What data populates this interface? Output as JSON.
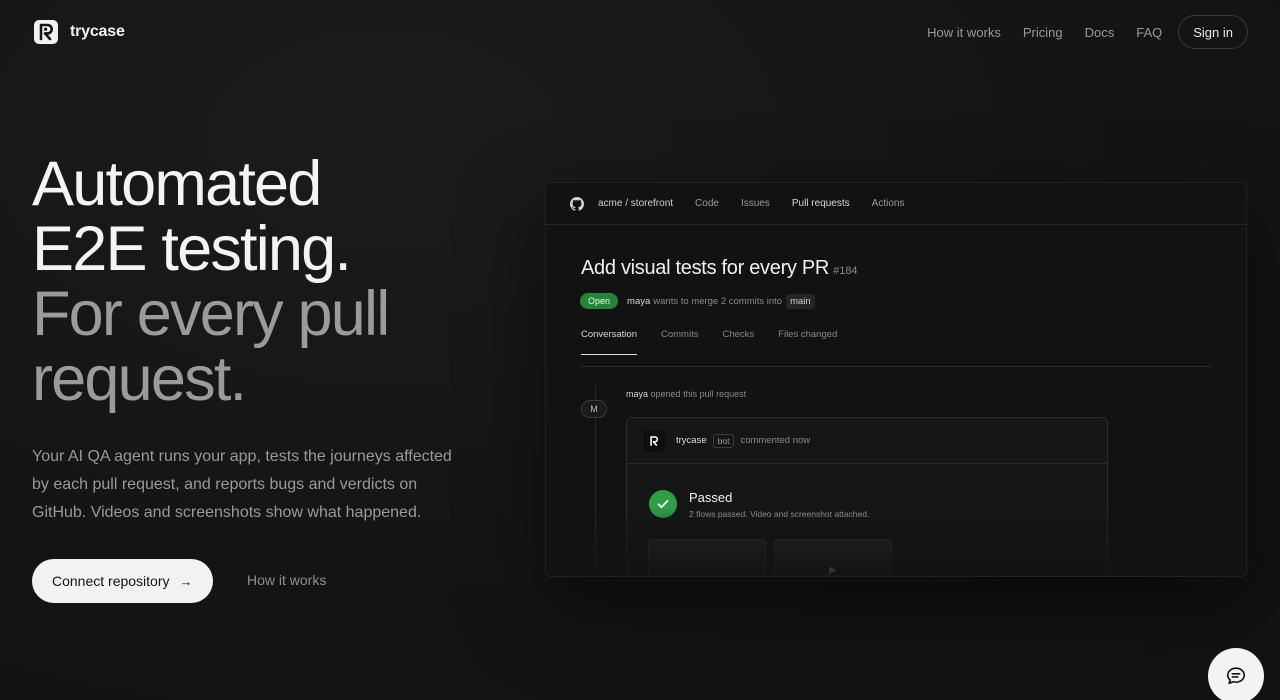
{
  "brand": {
    "name": "trycase"
  },
  "nav": {
    "items": [
      "How it works",
      "Pricing",
      "Docs",
      "FAQ"
    ],
    "signin": "Sign in"
  },
  "hero": {
    "line1": "Automated",
    "line2": "E2E testing.",
    "line3": "For every pull request.",
    "description": "Your AI QA agent runs your app, tests the journeys affected by each pull request, and reports bugs and verdicts on GitHub. Videos and screenshots show what happened.",
    "cta": "Connect repository",
    "cta_arrow": "→",
    "secondary": "How it works"
  },
  "mock": {
    "repo": "acme / storefront",
    "tabs": [
      "Code",
      "Issues",
      "Pull requests",
      "Actions"
    ],
    "pr_title": "Add visual tests for every PR",
    "pr_number": "#184",
    "status": "Open",
    "author": "maya",
    "meta_text": "wants to merge 2 commits into",
    "branch": "main",
    "pr_tabs": [
      "Conversation",
      "Commits",
      "Checks",
      "Files changed"
    ],
    "avatar_initial": "M",
    "opened_user": "maya",
    "opened_text": "opened this pull request",
    "comment": {
      "user": "trycase",
      "bot": "bot",
      "time": "commented now",
      "result_title": "Passed",
      "result_sub": "2 flows passed. Video and screenshot attached.",
      "play": "▶"
    }
  },
  "colors": {
    "accent_green": "#2ea043",
    "open_badge": "#238636",
    "background": "#141414"
  }
}
